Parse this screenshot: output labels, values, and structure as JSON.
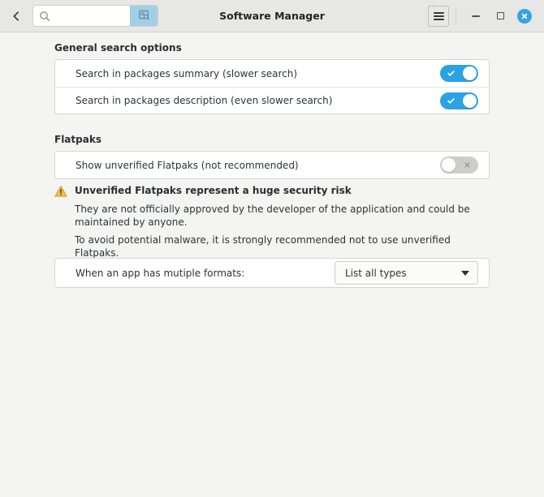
{
  "window": {
    "title": "Software Manager",
    "back_icon": "chevron-left-icon",
    "menu_icon": "hamburger-menu-icon",
    "minimize_icon": "minimize-icon",
    "maximize_icon": "maximize-icon",
    "close_icon": "close-icon"
  },
  "search": {
    "value": "",
    "placeholder": "",
    "icon": "search-icon",
    "button_icon": "package-search-icon",
    "button_color": "#a3cfe6"
  },
  "sections": {
    "general": {
      "heading": "General search options",
      "rows": [
        {
          "label": "Search in packages summary (slower search)",
          "state": "on"
        },
        {
          "label": "Search in packages description (even slower search)",
          "state": "on"
        }
      ]
    },
    "flatpaks": {
      "heading": "Flatpaks",
      "rows": [
        {
          "label": "Show unverified Flatpaks (not recommended)",
          "state": "off"
        }
      ]
    }
  },
  "warning": {
    "icon": "warning-triangle-icon",
    "title": "Unverified Flatpaks represent a huge security risk",
    "line1": "They are not officially approved by the developer of the application and could be maintained by anyone.",
    "line2": "To avoid potential malware, it is strongly recommended not to use unverified Flatpaks."
  },
  "formats": {
    "label": "When an app has mutiple formats:",
    "selected": "List all types",
    "caret_icon": "chevron-down-icon"
  },
  "colors": {
    "toggle_on": "#2ba3e3",
    "toggle_off": "#cdcdc9",
    "accent": "#35a4e0",
    "warning": "#f0b63c"
  }
}
